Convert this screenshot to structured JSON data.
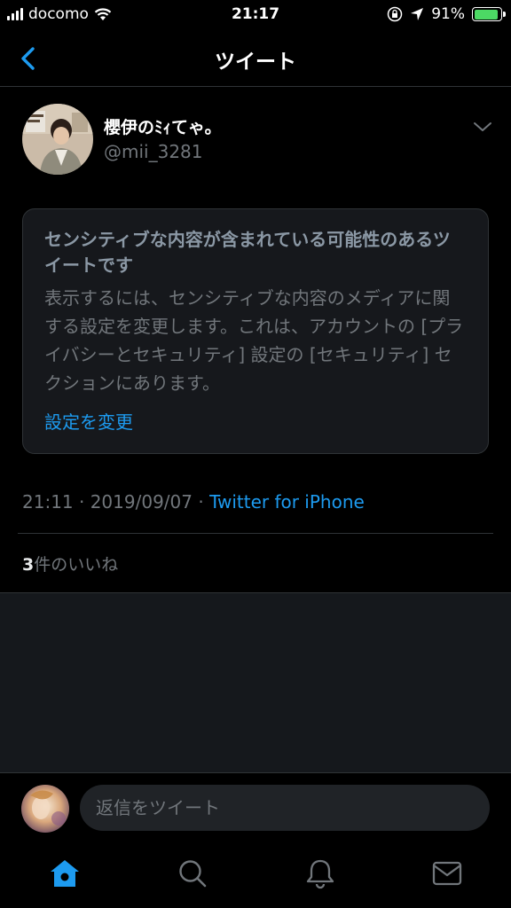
{
  "status_bar": {
    "carrier": "docomo",
    "time": "21:17",
    "battery_percent": "91%",
    "battery_level": 0.91,
    "icons": [
      "signal-icon",
      "wifi-icon",
      "orientation-lock-icon",
      "location-icon",
      "battery-icon"
    ]
  },
  "nav": {
    "title": "ツイート",
    "back_icon": "chevron-left-icon"
  },
  "tweet": {
    "user_name": "櫻伊のﾐｨてゃ。",
    "user_handle": "@mii_3281",
    "sensitive": {
      "title": "センシティブな内容が含まれている可能性のあるツイートです",
      "body": "表示するには、センシティブな内容のメディアに関する設定を変更します。これは、アカウントの [プライバシーとセキュリティ] 設定の [セキュリティ] セクションにあります。",
      "link": "設定を変更"
    },
    "timestamp": "21:11 · 2019/09/07 · ",
    "via": "Twitter for iPhone",
    "likes_count": "3",
    "likes_label": "件のいいね"
  },
  "reply": {
    "placeholder": "返信をツイート"
  },
  "tabs": [
    {
      "name": "home",
      "icon": "home-icon",
      "active": true
    },
    {
      "name": "search",
      "icon": "search-icon",
      "active": false
    },
    {
      "name": "notifications",
      "icon": "bell-icon",
      "active": false
    },
    {
      "name": "messages",
      "icon": "mail-icon",
      "active": false
    }
  ],
  "colors": {
    "accent": "#1d9bf0",
    "background": "#000000",
    "secondary_text": "#71767b",
    "battery": "#4cd964"
  }
}
